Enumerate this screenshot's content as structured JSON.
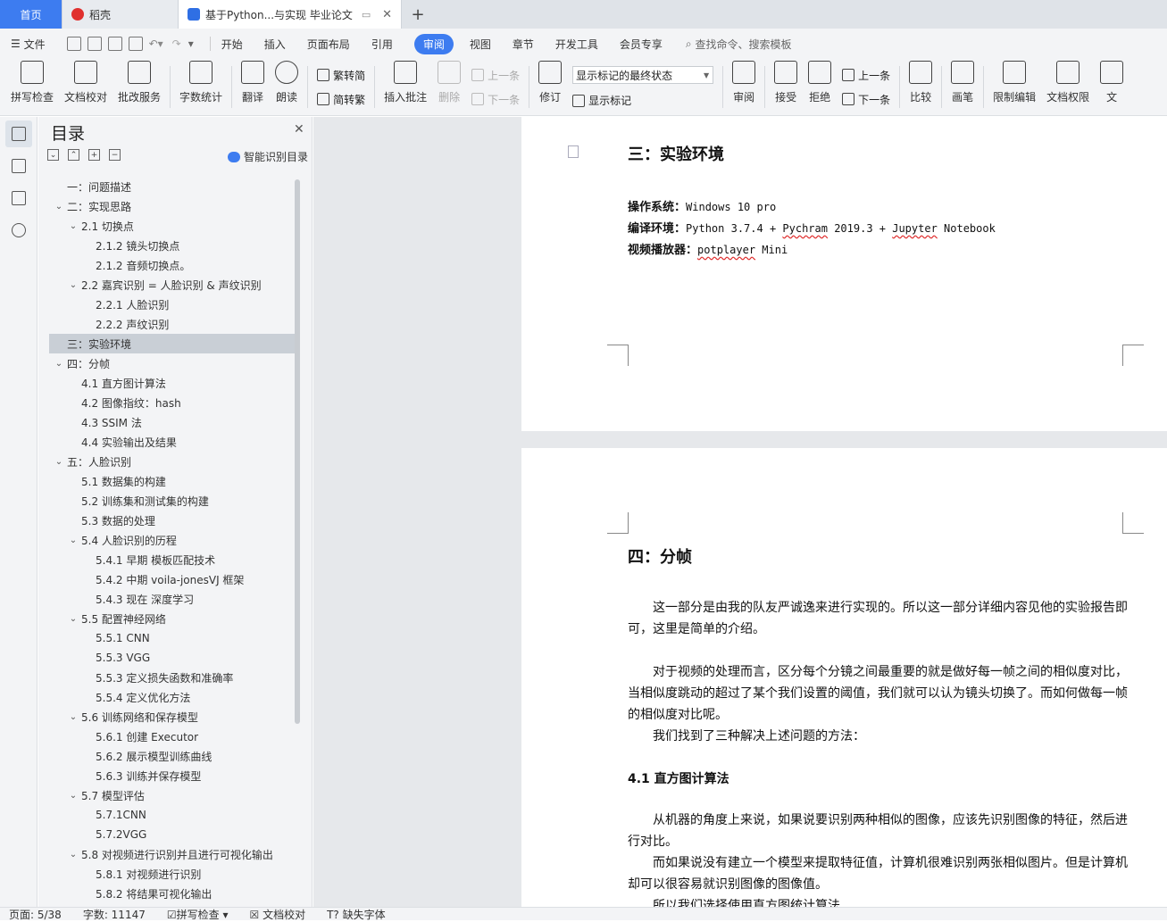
{
  "tabs": {
    "home": "首页",
    "daoke": "稻壳",
    "doc": "基于Python...与实现 毕业论文"
  },
  "menu": {
    "file": "文件",
    "items": [
      "开始",
      "插入",
      "页面布局",
      "引用",
      "审阅",
      "视图",
      "章节",
      "开发工具",
      "会员专享"
    ],
    "active": "审阅",
    "search": "查找命令、搜索模板"
  },
  "ribbon": {
    "spell": "拼写检查",
    "doccheck": "文档校对",
    "annotate_service": "批改服务",
    "wordcount": "字数统计",
    "translate": "翻译",
    "read": "朗读",
    "trad": "繁转简",
    "simp": "简转繁",
    "insert_comment": "插入批注",
    "delete": "删除",
    "prev_comment": "上一条",
    "next_comment": "下一条",
    "revise": "修订",
    "markup_state": "显示标记的最终状态",
    "show_markup": "显示标记",
    "review": "审阅",
    "accept": "接受",
    "reject": "拒绝",
    "prev": "上一条",
    "next": "下一条",
    "compare": "比较",
    "pen": "画笔",
    "restrict": "限制编辑",
    "permission": "文档权限",
    "more": "文"
  },
  "toc": {
    "title": "目录",
    "smart": "智能识别目录",
    "items": [
      {
        "level": 0,
        "caret": "",
        "text": "一：问题描述"
      },
      {
        "level": 0,
        "caret": "v",
        "text": "二：实现思路"
      },
      {
        "level": 1,
        "caret": "v",
        "text": "2.1  切换点"
      },
      {
        "level": 2,
        "caret": "",
        "text": "2.1.2  镜头切换点"
      },
      {
        "level": 2,
        "caret": "",
        "text": "2.1.2  音频切换点。"
      },
      {
        "level": 1,
        "caret": "v",
        "text": "2.2  嘉宾识别  =  人脸识别  &  声纹识别"
      },
      {
        "level": 2,
        "caret": "",
        "text": "2.2.1  人脸识别"
      },
      {
        "level": 2,
        "caret": "",
        "text": "2.2.2  声纹识别"
      },
      {
        "level": 0,
        "caret": "",
        "text": "三：实验环境",
        "selected": true
      },
      {
        "level": 0,
        "caret": "v",
        "text": "四：分帧"
      },
      {
        "level": 1,
        "caret": "",
        "text": "4.1  直方图计算法"
      },
      {
        "level": 1,
        "caret": "",
        "text": "4.2  图像指纹：hash"
      },
      {
        "level": 1,
        "caret": "",
        "text": "4.3 SSIM 法"
      },
      {
        "level": 1,
        "caret": "",
        "text": "4.4  实验输出及结果"
      },
      {
        "level": 0,
        "caret": "v",
        "text": "五：人脸识别"
      },
      {
        "level": 1,
        "caret": "",
        "text": "5.1  数据集的构建"
      },
      {
        "level": 1,
        "caret": "",
        "text": "5.2  训练集和测试集的构建"
      },
      {
        "level": 1,
        "caret": "",
        "text": "5.3  数据的处理"
      },
      {
        "level": 1,
        "caret": "v",
        "text": "5.4  人脸识别的历程"
      },
      {
        "level": 2,
        "caret": "",
        "text": "5.4.1  早期  模板匹配技术"
      },
      {
        "level": 2,
        "caret": "",
        "text": "5.4.2  中期  voila-jonesVJ 框架"
      },
      {
        "level": 2,
        "caret": "",
        "text": "5.4.3  现在  深度学习"
      },
      {
        "level": 1,
        "caret": "v",
        "text": "5.5  配置神经网络"
      },
      {
        "level": 2,
        "caret": "",
        "text": "5.5.1 CNN"
      },
      {
        "level": 2,
        "caret": "",
        "text": "5.5.3 VGG"
      },
      {
        "level": 2,
        "caret": "",
        "text": "5.5.3  定义损失函数和准确率"
      },
      {
        "level": 2,
        "caret": "",
        "text": "5.5.4  定义优化方法"
      },
      {
        "level": 1,
        "caret": "v",
        "text": "5.6  训练网络和保存模型"
      },
      {
        "level": 2,
        "caret": "",
        "text": "5.6.1 创建 Executor"
      },
      {
        "level": 2,
        "caret": "",
        "text": "5.6.2 展示模型训练曲线"
      },
      {
        "level": 2,
        "caret": "",
        "text": "5.6.3 训练并保存模型"
      },
      {
        "level": 1,
        "caret": "v",
        "text": "5.7  模型评估"
      },
      {
        "level": 2,
        "caret": "",
        "text": "5.7.1CNN"
      },
      {
        "level": 2,
        "caret": "",
        "text": "5.7.2VGG"
      },
      {
        "level": 1,
        "caret": "v",
        "text": "5.8  对视频进行识别并且进行可视化输出"
      },
      {
        "level": 2,
        "caret": "",
        "text": "5.8.1  对视频进行识别"
      },
      {
        "level": 2,
        "caret": "",
        "text": "5.8.2  将结果可视化输出"
      }
    ]
  },
  "doc": {
    "page1": {
      "heading": "三：实验环境",
      "os_label": "操作系统",
      "os_value": "Windows 10 pro",
      "env_label": "编译环境",
      "env_value_a": "Python 3.7.4 + ",
      "env_value_b": "Pychram",
      "env_value_c": " 2019.3 + ",
      "env_value_d": "Jupyter",
      "env_value_e": " Notebook",
      "player_label": "视频播放器",
      "player_value_a": "potplayer",
      "player_value_b": " Mini"
    },
    "page2": {
      "heading": "四：分帧",
      "p1": "这一部分是由我的队友严诚逸来进行实现的。所以这一部分详细内容见他的实验报告即可，这里是简单的介绍。",
      "p2": "对于视频的处理而言，区分每个分镜之间最重要的就是做好每一帧之间的相似度对比，当相似度跳动的超过了某个我们设置的阈值，我们就可以认为镜头切换了。而如何做每一帧的相似度对比呢。",
      "p3": "我们找到了三种解决上述问题的方法：",
      "h2": "4.1  直方图计算法",
      "p4": "从机器的角度上来说，如果说要识别两种相似的图像，应该先识别图像的特征，然后进行对比。",
      "p5": "而如果说没有建立一个模型来提取特征值，计算机很难识别两张相似图片。但是计算机却可以很容易就识别图像的图像值。",
      "p6": "所以我们选择使用直方图统计算法"
    }
  },
  "status": {
    "page": "页面: 5/38",
    "words": "字数: 11147",
    "spell": "拼写检查",
    "check": "文档校对",
    "font": "缺失字体"
  }
}
